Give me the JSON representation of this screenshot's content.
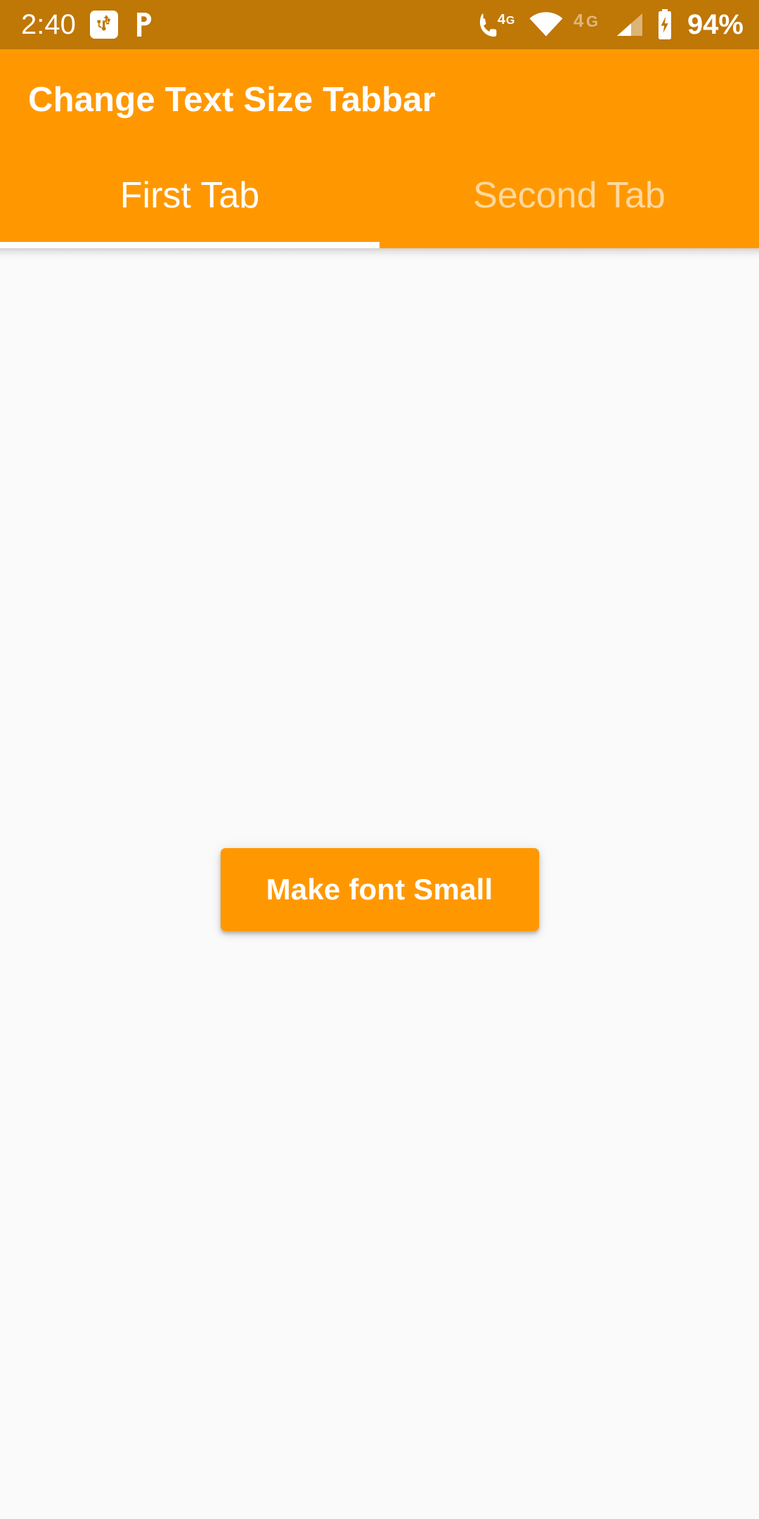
{
  "status_bar": {
    "background_color": "#bf7706",
    "foreground_color": "#ffffff",
    "clock": "2:40",
    "battery_percent": "94%",
    "icons": {
      "usb": "usb-icon",
      "pocket_p": "p-letter-icon",
      "volte": "volte-4g-icon",
      "volte_label": "4G",
      "wifi": "wifi-icon",
      "network_type": "4G",
      "signal": "signal-bars-icon",
      "battery": "battery-charging-icon"
    }
  },
  "app_bar": {
    "background_color": "#ff9800",
    "title": "Change Text Size Tabbar"
  },
  "tabs": {
    "indicator_color": "#ffffff",
    "selected_index": 0,
    "items": [
      {
        "label": "First Tab",
        "selected": true
      },
      {
        "label": "Second Tab",
        "selected": false
      }
    ]
  },
  "content": {
    "background_color": "#fafafa",
    "button": {
      "label": "Make font Small",
      "background_color": "#ff9800",
      "text_color": "#ffffff"
    }
  }
}
